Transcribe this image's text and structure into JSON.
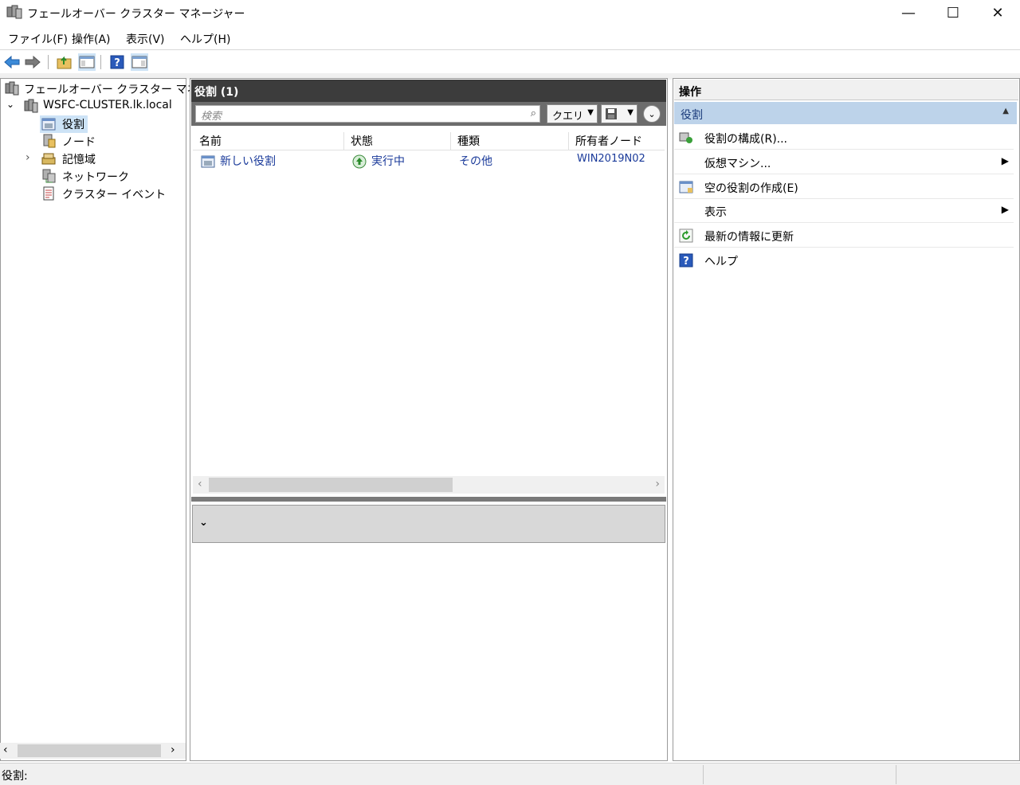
{
  "window": {
    "title": "フェールオーバー クラスター マネージャー",
    "minimize": "—",
    "maximize": "☐",
    "close": "✕"
  },
  "menu": [
    "ファイル(F)",
    "操作(A)",
    "表示(V)",
    "ヘルプ(H)"
  ],
  "tree": {
    "root": "フェールオーバー クラスター マネージャ",
    "cluster": "WSFC-CLUSTER.lk.local",
    "children": [
      "役割",
      "ノード",
      "記憶域",
      "ネットワーク",
      "クラスター イベント"
    ],
    "selected": "役割"
  },
  "center": {
    "header": "役割 (1)",
    "search_placeholder": "検索",
    "query_label": "クエリ",
    "columns": [
      "名前",
      "状態",
      "種類",
      "所有者ノード"
    ],
    "rows": [
      {
        "name": "新しい役割",
        "status": "実行中",
        "type": "その他",
        "owner": "WIN2019N02"
      }
    ]
  },
  "actions": {
    "header": "操作",
    "section": "役割",
    "items": [
      {
        "label": "役割の構成(R)...",
        "icon": "configure-role-icon",
        "submenu": false
      },
      {
        "label": "仮想マシン...",
        "icon": "",
        "submenu": true
      },
      {
        "label": "空の役割の作成(E)",
        "icon": "empty-role-icon",
        "submenu": false
      },
      {
        "label": "表示",
        "icon": "",
        "submenu": true
      },
      {
        "label": "最新の情報に更新",
        "icon": "refresh-icon",
        "submenu": false
      },
      {
        "label": "ヘルプ",
        "icon": "help-icon",
        "submenu": false
      }
    ]
  },
  "status": {
    "text": "役割:"
  },
  "colors": {
    "selection": "#cde3f6",
    "header_dark": "#3c3c3c",
    "link": "#1a3a9a",
    "action_section": "#bdd3ea"
  }
}
